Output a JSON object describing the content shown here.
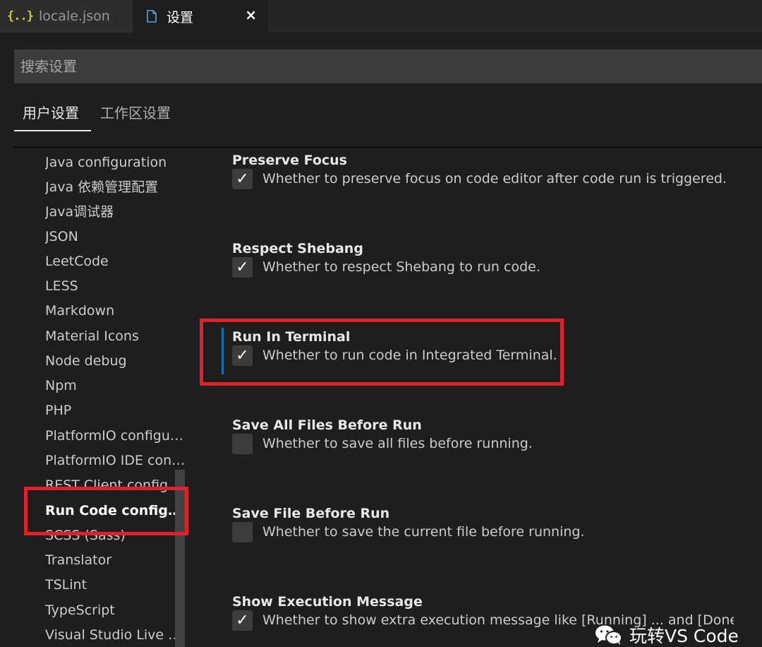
{
  "tabs": [
    {
      "icon": "json-braces-icon",
      "label": "locale.json",
      "active": false
    },
    {
      "icon": "file-icon",
      "label": "设置",
      "active": true,
      "close": "×"
    }
  ],
  "search": {
    "placeholder": "搜索设置"
  },
  "scope_tabs": [
    {
      "label": "用户设置",
      "active": true
    },
    {
      "label": "工作区设置",
      "active": false
    }
  ],
  "toc": [
    {
      "label": "Java configuration"
    },
    {
      "label": "Java 依赖管理配置"
    },
    {
      "label": "Java调试器"
    },
    {
      "label": "JSON"
    },
    {
      "label": "LeetCode"
    },
    {
      "label": "LESS"
    },
    {
      "label": "Markdown"
    },
    {
      "label": "Material Icons"
    },
    {
      "label": "Node debug"
    },
    {
      "label": "Npm"
    },
    {
      "label": "PHP"
    },
    {
      "label": "PlatformIO configur..."
    },
    {
      "label": "PlatformIO IDE conf..."
    },
    {
      "label": "REST Client configu..."
    },
    {
      "label": "Run Code configu...",
      "active": true
    },
    {
      "label": "SCSS (Sass)"
    },
    {
      "label": "Translator"
    },
    {
      "label": "TSLint"
    },
    {
      "label": "TypeScript"
    },
    {
      "label": "Visual Studio Live S..."
    }
  ],
  "settings": [
    {
      "title": "Preserve Focus",
      "checked": true,
      "description": "Whether to preserve focus on code editor after code run is triggered."
    },
    {
      "title": "Respect Shebang",
      "checked": true,
      "description": "Whether to respect Shebang to run code."
    },
    {
      "title": "Run In Terminal",
      "checked": true,
      "description": "Whether to run code in Integrated Terminal."
    },
    {
      "title": "Save All Files Before Run",
      "checked": false,
      "description": "Whether to save all files before running."
    },
    {
      "title": "Save File Before Run",
      "checked": false,
      "description": "Whether to save the current file before running."
    },
    {
      "title": "Show Execution Message",
      "checked": true,
      "description": "Whether to show extra execution message like [Running] ... and [Done] ..."
    }
  ],
  "checkmark": "✓",
  "watermark": {
    "icon": "wechat-icon",
    "text": "玩转VS Code"
  },
  "colors": {
    "highlight": "#e0202a",
    "focus_bar": "#0e70c0",
    "json_icon": "#cbcb41",
    "file_icon": "#4fa8e8"
  }
}
